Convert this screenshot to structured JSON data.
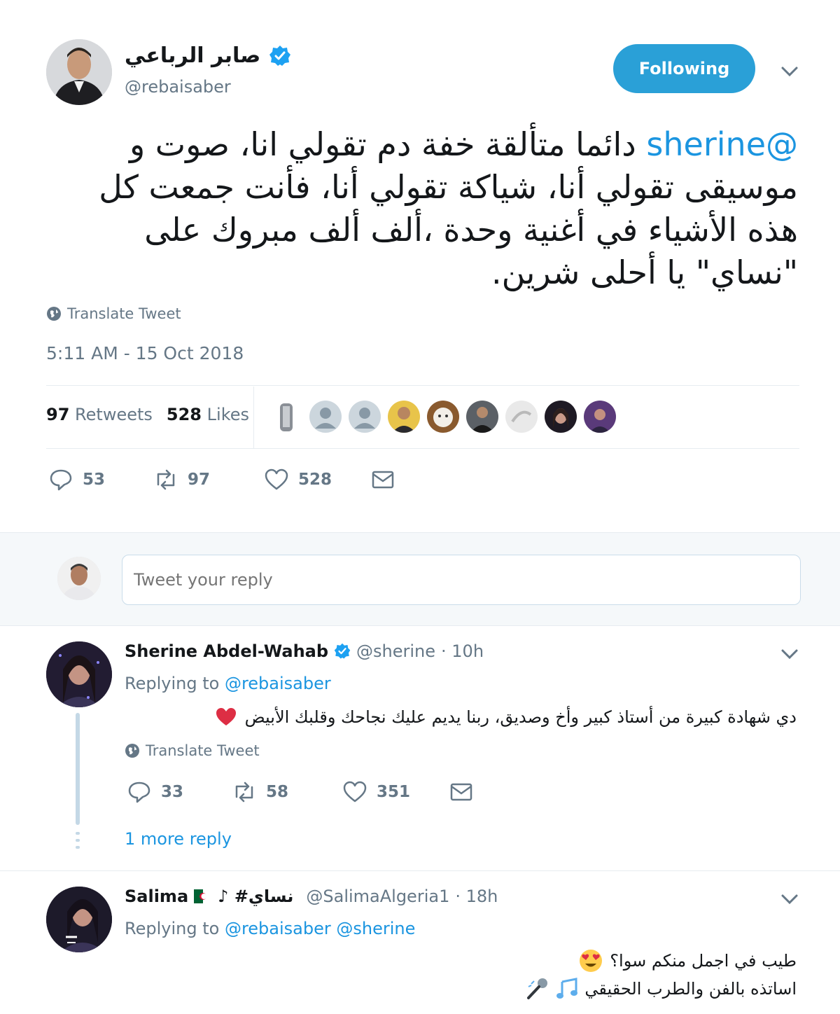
{
  "main_tweet": {
    "display_name": "صابر الرباعي",
    "handle": "@rebaisaber",
    "follow_label": "Following",
    "mention": "@sherine",
    "text": "دائما متألقة خفة دم تقولي انا، صوت و موسيقى تقولي أنا، شياكة تقولي أنا، فأنت جمعت كل هذه الأشياء في أغنية وحدة ،ألف ألف مبروك على \"نساي\" يا أحلى شرين.",
    "translate_label": "Translate Tweet",
    "timestamp": "5:11 AM - 15 Oct 2018",
    "retweets_count": "97",
    "retweets_label": "Retweets",
    "likes_count": "528",
    "likes_label": "Likes",
    "actions": {
      "replies": "53",
      "retweets": "97",
      "likes": "528"
    }
  },
  "reply_box": {
    "placeholder": "Tweet your reply"
  },
  "replies": [
    {
      "display_name": "Sherine Abdel-Wahab",
      "handle": "@sherine",
      "time": "· 10h",
      "replying_label": "Replying to",
      "replying_to": "@rebaisaber",
      "text": "دي شهادة كبيرة من أستاذ كبير وأخ وصديق، ربنا يديم عليك نجاحك وقلبك الأبيض",
      "translate_label": "Translate Tweet",
      "actions": {
        "replies": "33",
        "retweets": "58",
        "likes": "351"
      },
      "more_replies": "1 more reply"
    },
    {
      "display_name": "Salima",
      "name_suffix": "♪ #نساي",
      "handle": "@SalimaAlgeria1",
      "time": "· 18h",
      "replying_label": "Replying to",
      "replying_to": "@rebaisaber @sherine",
      "text_line1": "طيب في اجمل منكم سوا؟",
      "text_line2": "اساتذه بالفن والطرب الحقيقي"
    }
  ],
  "colors": {
    "accent": "#1b95e0",
    "follow_button": "#2aa0d7",
    "muted": "#657786",
    "heart": "#e0245e"
  },
  "icons": [
    "verified-icon",
    "chevron-down-icon",
    "globe-icon",
    "reply-icon",
    "retweet-icon",
    "like-icon",
    "message-icon",
    "heart-emoji",
    "algeria-flag-emoji",
    "heart-eyes-emoji",
    "music-notes-emoji",
    "microphone-emoji"
  ]
}
